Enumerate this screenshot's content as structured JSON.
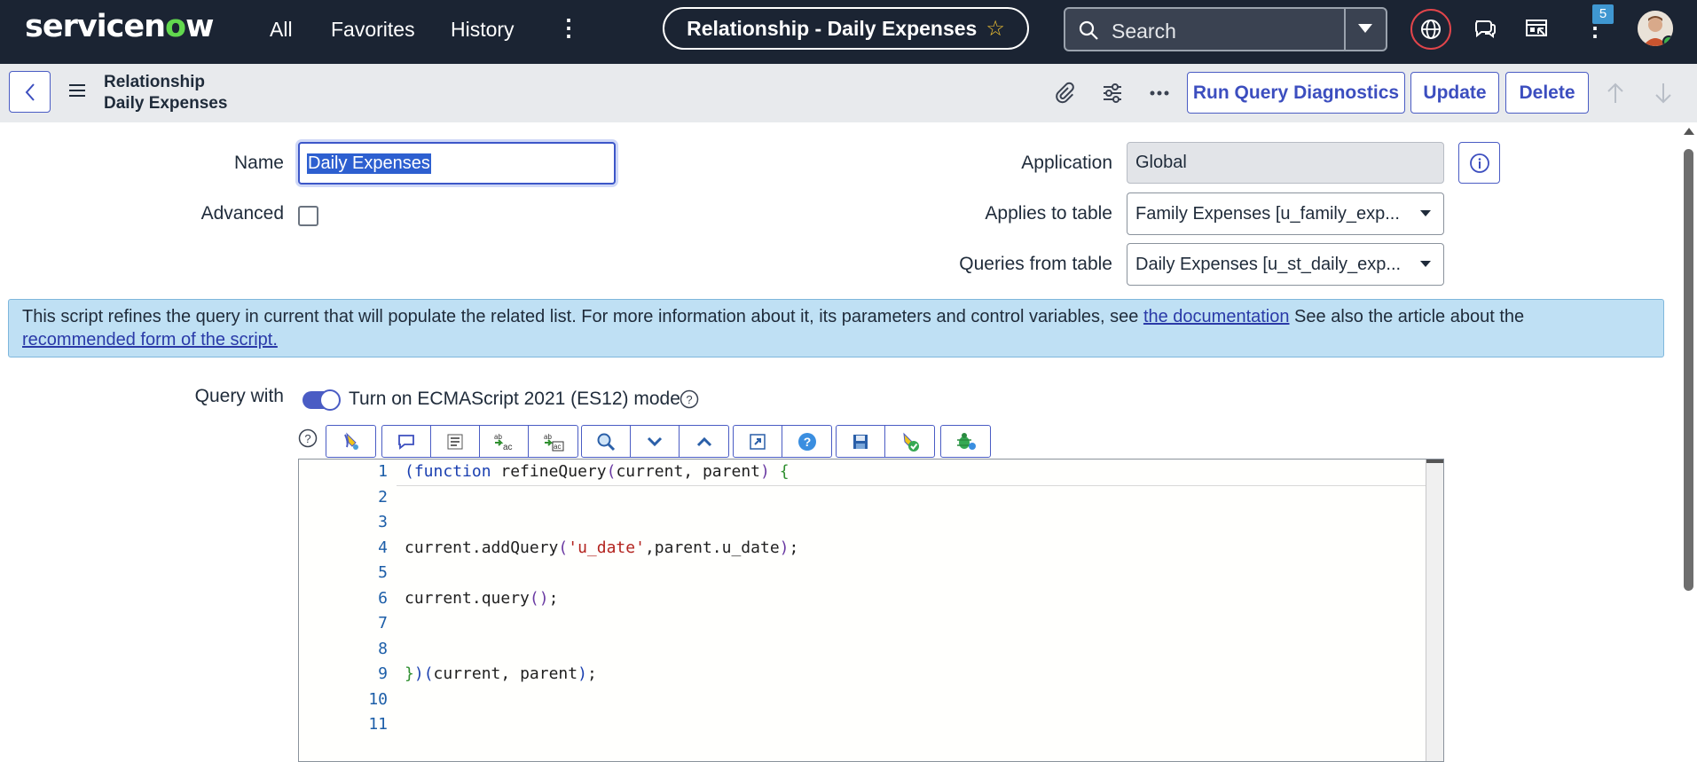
{
  "topnav": {
    "logo_pre": "servicen",
    "logo_o": "o",
    "logo_post": "w",
    "links": [
      "All",
      "Favorites",
      "History"
    ],
    "title": "Relationship - Daily Expenses",
    "search_placeholder": "Search",
    "notification_count": "5",
    "icons": [
      "search-icon",
      "globe-icon",
      "chat-icon",
      "admin-icon",
      "more-icon"
    ]
  },
  "header": {
    "record_type": "Relationship",
    "record_name": "Daily Expenses",
    "buttons": {
      "diagnostics": "Run Query Diagnostics",
      "update": "Update",
      "delete": "Delete"
    }
  },
  "form": {
    "name_label": "Name",
    "name_value": "Daily Expenses",
    "advanced_label": "Advanced",
    "advanced_checked": false,
    "application_label": "Application",
    "application_value": "Global",
    "applies_to_label": "Applies to table",
    "applies_to_value": "Family Expenses [u_family_exp...",
    "queries_from_label": "Queries from table",
    "queries_from_value": "Daily Expenses [u_st_daily_exp...",
    "query_with_label": "Query with",
    "es_mode_label": "Turn on ECMAScript 2021 (ES12) mode",
    "es_mode_on": true
  },
  "info": {
    "text_before": "This script refines the query in current that will populate the related list. For more information about it, its parameters and control variables, see ",
    "link1": "the documentation",
    "text_middle": " See also the article about the ",
    "link2": "recommended form of the script."
  },
  "editor": {
    "line_numbers": [
      "1",
      "2",
      "3",
      "4",
      "5",
      "6",
      "7",
      "8",
      "9",
      "10",
      "11"
    ],
    "toolbar_icons": [
      "toggle-comment-icon",
      "comment-icon",
      "format-code-icon",
      "replace-icon",
      "replace-all-icon",
      "search-icon",
      "next-match-icon",
      "previous-match-icon",
      "fullscreen-icon",
      "help-icon",
      "save-icon",
      "check-syntax-icon",
      "debug-icon"
    ]
  },
  "colors": {
    "nav_bg": "#1b2433",
    "accent": "#4a5cc4",
    "info_bg": "#bfe0f4",
    "logo_green": "#62d84e"
  }
}
